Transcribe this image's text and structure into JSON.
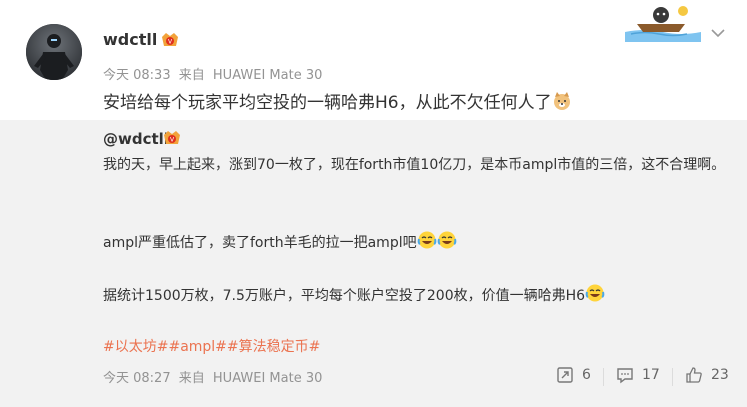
{
  "post": {
    "username": "wdctll",
    "time": "今天 08:33",
    "source_prefix": "来自",
    "source": "HUAWEI Mate 30",
    "text": "安培给每个玩家平均空投的一辆哈弗H6，从此不欠任何人了"
  },
  "repost": {
    "username": "@wdctll",
    "para1": "我的天，早上起来，涨到70一枚了，现在forth市值10亿刀，是本币ampl市值的三倍，这不合理啊。",
    "para2": "ampl严重低估了，卖了forth羊毛的拉一把ampl吧",
    "para3": "据统计1500万枚，7.5万账户，平均每个账户空投了200枚，价值一辆哈弗H6",
    "topics": "#以太坊##ampl##算法稳定币#",
    "time": "今天 08:27",
    "source_prefix": "来自",
    "source": "HUAWEI Mate 30",
    "reposts": "6",
    "comments": "17",
    "likes": "23"
  },
  "icons": {
    "vip": "vip-badge-icon",
    "doge": "doge-emoji-icon",
    "laugh_cry": "laugh-cry-emoji-icon",
    "repost": "repost-icon",
    "comment": "comment-icon",
    "like": "like-icon",
    "chevron": "chevron-down-icon"
  },
  "colors": {
    "topic": "#eb7350",
    "meta": "#939393",
    "repost_bg": "#f2f2f2"
  }
}
